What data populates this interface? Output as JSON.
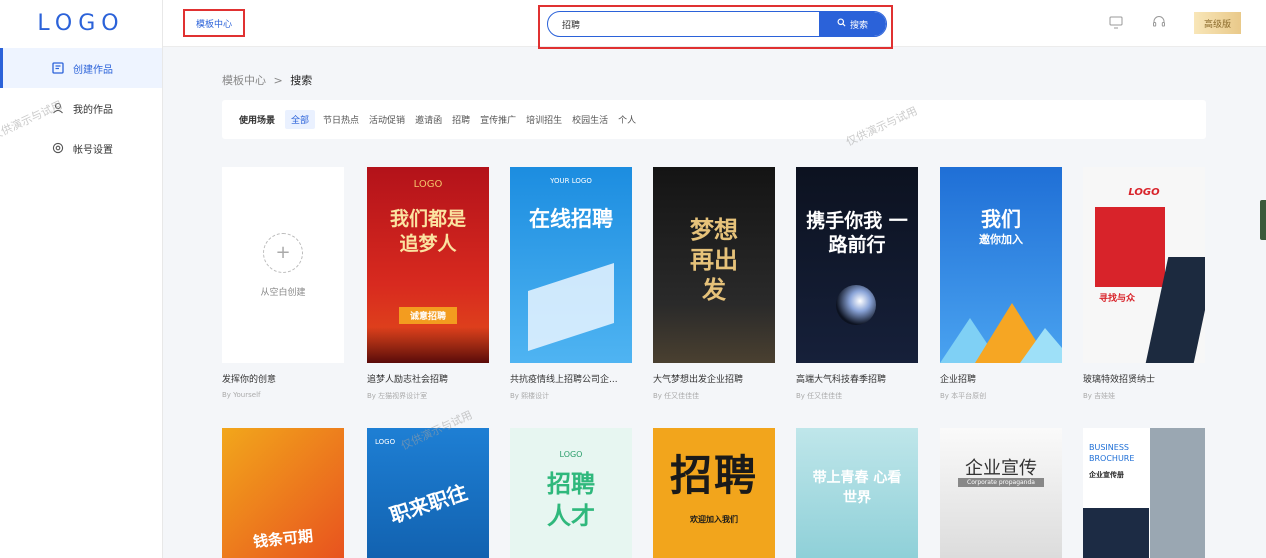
{
  "sidebar": {
    "logo": "LOGO",
    "items": [
      {
        "label": "创建作品",
        "icon": "edit-icon",
        "active": true
      },
      {
        "label": "我的作品",
        "icon": "user-icon",
        "active": false
      },
      {
        "label": "帐号设置",
        "icon": "settings-icon",
        "active": false
      }
    ]
  },
  "header": {
    "template_center": "模板中心",
    "search": {
      "value": "招聘",
      "button_label": "搜索"
    },
    "vip_label": "高级版"
  },
  "breadcrumb": {
    "parent": "模板中心",
    "separator": ">",
    "current": "搜索"
  },
  "filters": {
    "label": "使用场景",
    "items": [
      "全部",
      "节日热点",
      "活动促销",
      "邀请函",
      "招聘",
      "宣传推广",
      "培训招生",
      "校园生活",
      "个人"
    ],
    "active_index": 0
  },
  "blank_card": {
    "text": "从空白创建",
    "title": "发挥你的创意",
    "author": "By Yourself"
  },
  "cards_row1": [
    {
      "title": "追梦人励志社会招聘",
      "author": "By 左猫视界设计室",
      "poster_main": "我们都是 追梦人",
      "poster_sub": "诚意招聘",
      "poster_logo": "LOGO"
    },
    {
      "title": "共抗疫情线上招聘公司企...",
      "author": "By 熙楼设计",
      "poster_main": "在线招聘",
      "poster_sub": "YOUR LOGO"
    },
    {
      "title": "大气梦想出发企业招聘",
      "author": "By 任又佳佳佳",
      "poster_main": "梦想再出发"
    },
    {
      "title": "高端大气科技春季招聘",
      "author": "By 任又佳佳佳",
      "poster_main": "携手你我 一路前行"
    },
    {
      "title": "企业招聘",
      "author": "By 本平台原创",
      "poster_main": "我们",
      "poster_sub": "邀你加入"
    },
    {
      "title": "玻璃特效招贤纳士",
      "author": "By 吉娃娃",
      "poster_main": "寻找与众",
      "poster_logo": "LOGO"
    }
  ],
  "cards_row2": [
    {
      "poster_main": "钱条可期"
    },
    {
      "poster_main": "职来职往",
      "poster_logo": "LOGO"
    },
    {
      "poster_main": "招聘人才",
      "poster_logo": "LOGO"
    },
    {
      "poster_main": "招聘",
      "poster_sub": "欢迎加入我们"
    },
    {
      "poster_main": "带上青春 心看世界"
    },
    {
      "poster_main": "企业宣传",
      "poster_sub": "Corporate propaganda"
    },
    {
      "poster_main": "BUSINESS BROCHURE",
      "poster_sub": "企业宣传册"
    }
  ],
  "watermark": "仅供演示与试用",
  "colors": {
    "accent": "#2b62d9",
    "highlight_border": "#e03131",
    "background": "#f4f6f9"
  }
}
